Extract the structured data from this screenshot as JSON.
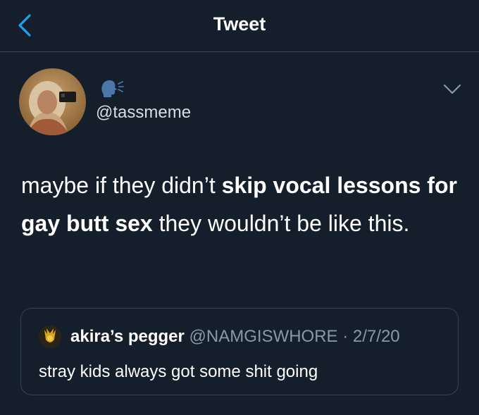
{
  "header": {
    "title": "Tweet",
    "back_icon": "chevron-left-icon"
  },
  "author": {
    "handle": "@tassmeme",
    "display_icon": "speaking-head-icon"
  },
  "tweet": {
    "segments": [
      {
        "text": "maybe if they didn’t ",
        "bold": false
      },
      {
        "text": "skip vocal lessons for gay butt sex",
        "bold": true
      },
      {
        "text": " they wouldn’t be like this.",
        "bold": false
      }
    ]
  },
  "quote": {
    "name": "akira’s pegger",
    "handle": "@NAMGISWHORE",
    "separator": "·",
    "date": "2/7/20",
    "text": "stray kids always got some shit going"
  },
  "colors": {
    "background": "#151f2b",
    "accent": "#1da1f2",
    "muted": "#8899a6",
    "border": "#37434f"
  }
}
